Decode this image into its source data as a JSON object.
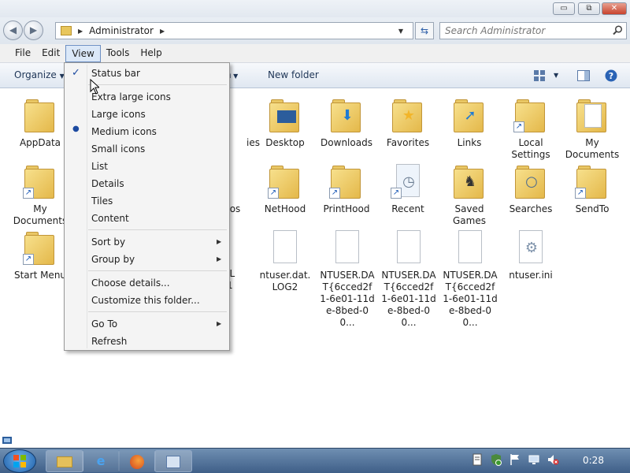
{
  "window": {
    "minimize": "▭",
    "maximize": "⧉",
    "close": "✕"
  },
  "address": {
    "path": "Administrator",
    "search_placeholder": "Search Administrator"
  },
  "menubar": {
    "items": [
      {
        "label": "File"
      },
      {
        "label": "Edit"
      },
      {
        "label": "View"
      },
      {
        "label": "Tools"
      },
      {
        "label": "Help"
      }
    ]
  },
  "toolbar": {
    "organize": "Organize",
    "new_folder": "New folder"
  },
  "view_menu": {
    "status_bar": "Status bar",
    "extra_large_icons": "Extra large icons",
    "large_icons": "Large icons",
    "medium_icons": "Medium icons",
    "small_icons": "Small icons",
    "list": "List",
    "details": "Details",
    "tiles": "Tiles",
    "content": "Content",
    "sort_by": "Sort by",
    "group_by": "Group by",
    "choose_details": "Choose details...",
    "customize_folder": "Customize this folder...",
    "go_to": "Go To",
    "refresh": "Refresh"
  },
  "files": {
    "appdata": "AppData",
    "desktop": "Desktop",
    "downloads": "Downloads",
    "favorites": "Favorites",
    "links": "Links",
    "local_settings": "Local Settings",
    "my_documents": "My Documents",
    "my_documents_sc": "My Documents",
    "nethood": "NetHood",
    "printhood": "PrintHood",
    "recent": "Recent",
    "saved_games": "Saved Games",
    "searches": "Searches",
    "sendto": "SendTo",
    "start_menu": "Start Menu",
    "ntuser_log2": "ntuser.dat.LOG2",
    "ntuser_dat_1": "NTUSER.DAT{6cced2f1-6e01-11de-8bed-00...",
    "ntuser_dat_2": "NTUSER.DAT{6cced2f1-6e01-11de-8bed-00...",
    "ntuser_dat_3": "NTUSER.DAT{6cced2f1-6e01-11de-8bed-00...",
    "ntuser_ini": "ntuser.ini",
    "partial_1": "ies",
    "partial_2": "deos",
    "partial_3": "dat.L",
    "partial_3b": "1"
  },
  "taskbar": {
    "clock": "0:28"
  }
}
